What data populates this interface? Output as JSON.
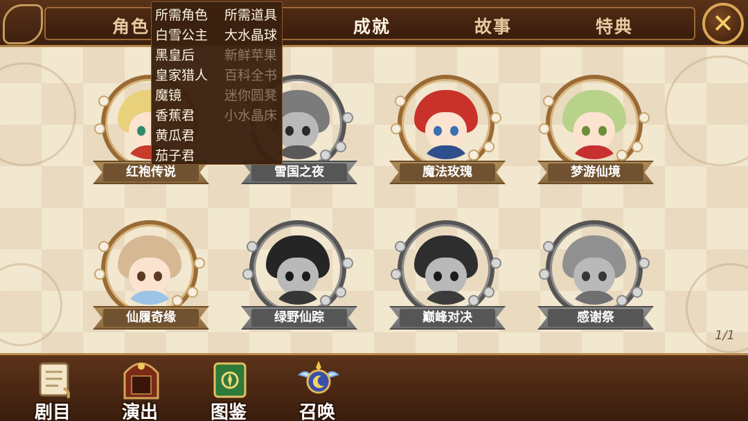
{
  "top_tabs": [
    {
      "label": "角色",
      "active": false
    },
    {
      "label": "成就",
      "active": true
    },
    {
      "label": "故事",
      "active": false
    },
    {
      "label": "特典",
      "active": false
    }
  ],
  "close_icon": "close-x-icon",
  "dropdown": {
    "left_header": "所需角色",
    "right_header": "所需道具",
    "characters": [
      "白雪公主",
      "黑皇后",
      "皇家猎人",
      "魔镜",
      "香蕉君",
      "黄瓜君",
      "茄子君"
    ],
    "items": [
      {
        "label": "大水晶球",
        "available": true
      },
      {
        "label": "新鲜苹果",
        "available": false
      },
      {
        "label": "百科全书",
        "available": false
      },
      {
        "label": "迷你圆凳",
        "available": false
      },
      {
        "label": "小水晶床",
        "available": false
      }
    ]
  },
  "cards": [
    {
      "title": "红袍传说",
      "locked": false,
      "hair": "#e9d07a",
      "outfit": "#c83a2a",
      "eye": "#2f8a6c"
    },
    {
      "title": "雪国之夜",
      "locked": true,
      "hair": "#9a9a9a",
      "outfit": "#6f6f6f",
      "eye": "#333333"
    },
    {
      "title": "魔法玫瑰",
      "locked": false,
      "hair": "#c8322a",
      "outfit": "#2f4f8c",
      "eye": "#3a6fb0"
    },
    {
      "title": "梦游仙境",
      "locked": false,
      "hair": "#b9d28a",
      "outfit": "#c63030",
      "eye": "#6a8e3a"
    },
    {
      "title": "仙履奇缘",
      "locked": false,
      "hair": "#d7b895",
      "outfit": "#9cc4e6",
      "eye": "#5a3a22"
    },
    {
      "title": "绿野仙踪",
      "locked": true,
      "hair": "#2e2e2e",
      "outfit": "#444444",
      "eye": "#222222"
    },
    {
      "title": "巅峰对决",
      "locked": true,
      "hair": "#3a3a3a",
      "outfit": "#4a4a4a",
      "eye": "#222222"
    },
    {
      "title": "感谢祭",
      "locked": true,
      "hair": "#b4b4b4",
      "outfit": "#8c8c8c",
      "eye": "#444444"
    }
  ],
  "page_indicator": "1/1",
  "bottom_nav": [
    {
      "label": "剧目",
      "icon": "scroll-icon"
    },
    {
      "label": "演出",
      "icon": "stage-icon"
    },
    {
      "label": "图鉴",
      "icon": "book-icon"
    },
    {
      "label": "召唤",
      "icon": "summon-orb-icon"
    }
  ]
}
